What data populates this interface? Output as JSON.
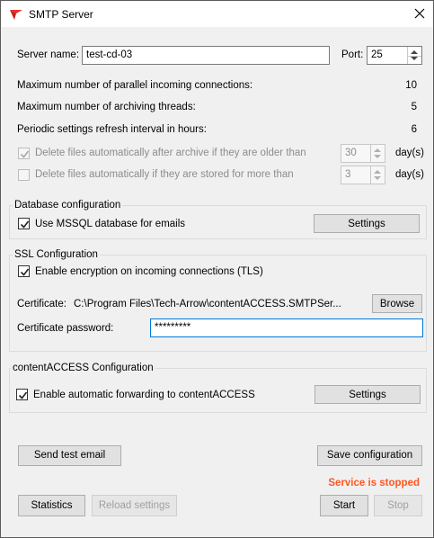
{
  "window": {
    "title": "SMTP Server"
  },
  "server": {
    "name_label": "Server name:",
    "name_value": "test-cd-03",
    "port_label": "Port:",
    "port_value": "25"
  },
  "stats": [
    {
      "label": "Maximum number of parallel incoming connections:",
      "value": "10"
    },
    {
      "label": "Maximum number of archiving threads:",
      "value": "5"
    },
    {
      "label": "Periodic settings refresh interval in hours:",
      "value": "6"
    }
  ],
  "delete_options": [
    {
      "label": "Delete files automatically after archive if they are older than",
      "checked": true,
      "value": "30",
      "unit": "day(s)"
    },
    {
      "label": "Delete files automatically if they are stored for more than",
      "checked": false,
      "value": "3",
      "unit": "day(s)"
    }
  ],
  "database": {
    "group_title": "Database configuration",
    "checkbox_label": "Use MSSQL database for emails",
    "checked": true,
    "settings_button": "Settings"
  },
  "ssl": {
    "group_title": "SSL Configuration",
    "checkbox_label": "Enable encryption on incoming connections (TLS)",
    "checked": true,
    "certificate_label": "Certificate:",
    "certificate_path": "C:\\Program Files\\Tech-Arrow\\contentACCESS.SMTPSer...",
    "browse_button": "Browse",
    "password_label": "Certificate password:",
    "password_value": "*********"
  },
  "contentaccess": {
    "group_title": "contentACCESS Configuration",
    "checkbox_label": "Enable automatic forwarding to contentACCESS",
    "checked": true,
    "settings_button": "Settings"
  },
  "buttons": {
    "send_test_email": "Send test email",
    "save_configuration": "Save configuration",
    "statistics": "Statistics",
    "reload_settings": "Reload settings",
    "start": "Start",
    "stop": "Stop"
  },
  "status": {
    "text": "Service is stopped",
    "color": "#ff5722"
  },
  "colors": {
    "focus_border": "#0078d7",
    "app_icon": "#e8322e"
  }
}
